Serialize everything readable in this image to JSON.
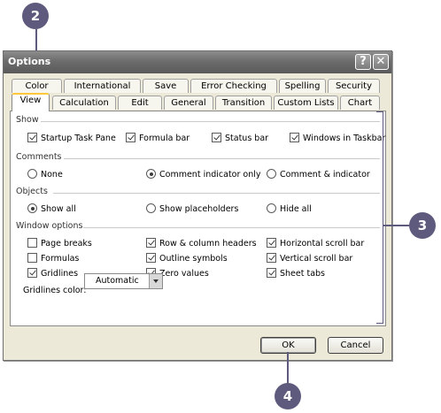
{
  "dialog": {
    "title": "Options",
    "help_btn": "?",
    "close_btn": "✕"
  },
  "tabs_row1": [
    "Color",
    "International",
    "Save",
    "Error Checking",
    "Spelling",
    "Security"
  ],
  "tabs_row2": [
    "View",
    "Calculation",
    "Edit",
    "General",
    "Transition",
    "Custom Lists",
    "Chart"
  ],
  "active_tab": "View",
  "show": {
    "label": "Show",
    "startup_task_pane": "Startup Task Pane",
    "formula_bar": "Formula bar",
    "status_bar": "Status bar",
    "windows_in_taskbar": "Windows in Taskbar"
  },
  "comments": {
    "label": "Comments",
    "none": "None",
    "indicator_only": "Comment indicator only",
    "comment_and_indicator": "Comment & indicator"
  },
  "objects": {
    "label": "Objects",
    "show_all": "Show all",
    "show_placeholders": "Show placeholders",
    "hide_all": "Hide all"
  },
  "window_options": {
    "label": "Window options",
    "page_breaks": "Page breaks",
    "formulas": "Formulas",
    "gridlines": "Gridlines",
    "row_col_headers": "Row & column headers",
    "outline_symbols": "Outline symbols",
    "zero_values": "Zero values",
    "horizontal_scroll": "Horizontal scroll bar",
    "vertical_scroll": "Vertical scroll bar",
    "sheet_tabs": "Sheet tabs",
    "gridlines_color_label": "Gridlines color:",
    "gridlines_color_value": "Automatic"
  },
  "buttons": {
    "ok": "OK",
    "cancel": "Cancel"
  },
  "callouts": {
    "c2": "2",
    "c3": "3",
    "c4": "4"
  },
  "colors": {
    "callout": "#5e5a7d",
    "dialog_bg": "#ece9d8",
    "title_bar": "#6c6c6c",
    "active_tab_accent": "#ffc83c"
  }
}
